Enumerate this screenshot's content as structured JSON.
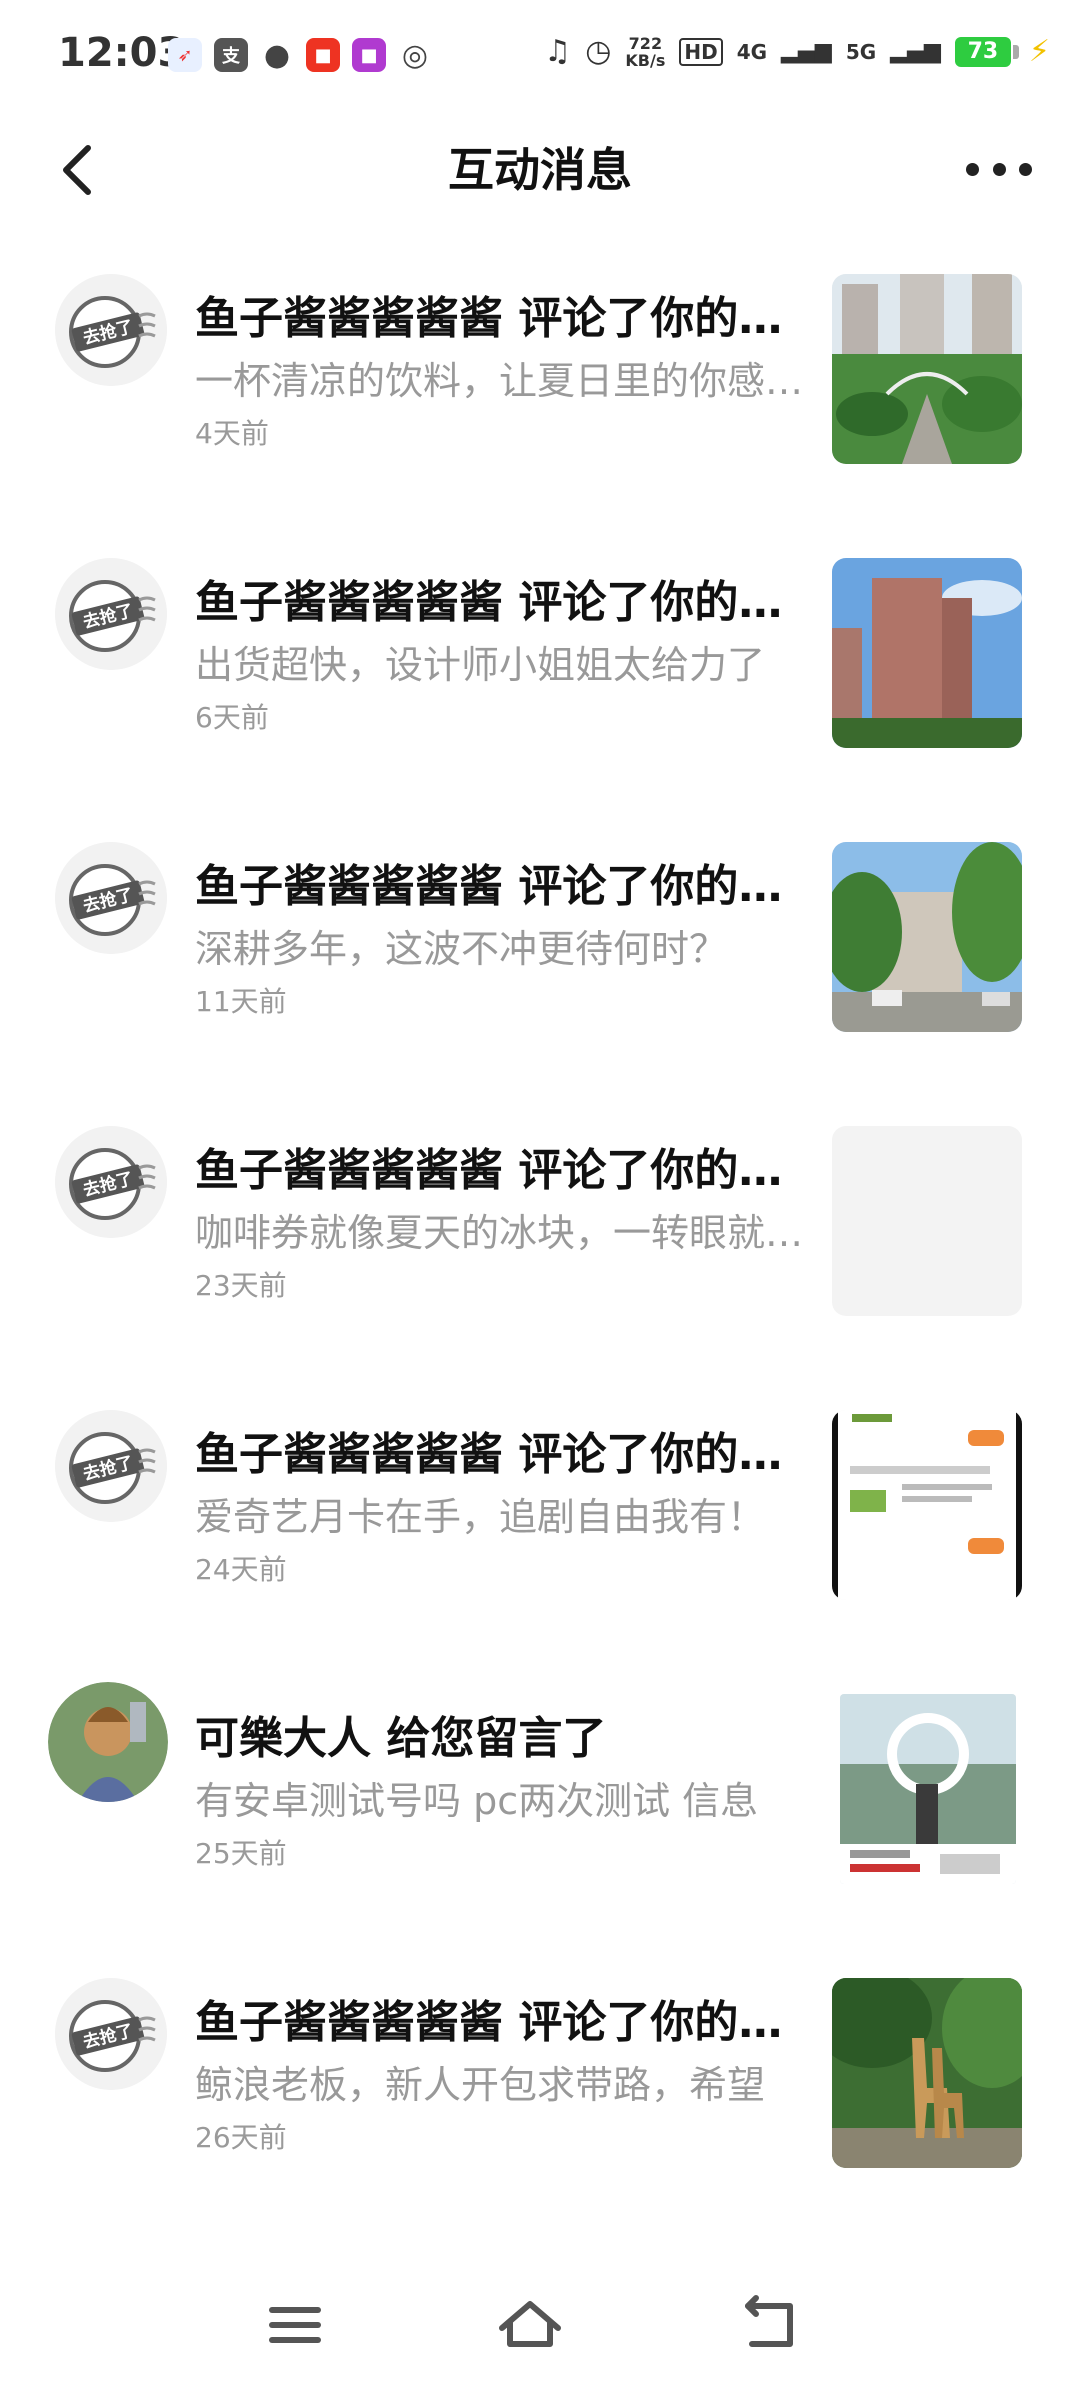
{
  "status_bar": {
    "time": "12:03",
    "net_speed_value": "722",
    "net_speed_unit": "KB/s",
    "hd_label": "HD",
    "signal_1": "4G",
    "signal_2": "5G",
    "battery": "73"
  },
  "header": {
    "title": "互动消息"
  },
  "messages": [
    {
      "title": "鱼子酱酱酱酱酱 评论了你的动态",
      "preview": "一杯清凉的饮料，让夏日里的你感到清爽",
      "time": "4天前",
      "avatar": "去抢了"
    },
    {
      "title": "鱼子酱酱酱酱酱 评论了你的动态",
      "preview": "出货超快，设计师小姐姐太给力了",
      "time": "6天前",
      "avatar": "去抢了"
    },
    {
      "title": "鱼子酱酱酱酱酱 评论了你的动态",
      "preview": "深耕多年，这波不冲更待何时？",
      "time": "11天前",
      "avatar": "去抢了"
    },
    {
      "title": "鱼子酱酱酱酱酱 评论了你的动态",
      "preview": "咖啡券就像夏天的冰块，一转眼就没了",
      "time": "23天前",
      "avatar": "去抢了"
    },
    {
      "title": "鱼子酱酱酱酱酱 评论了你的动态",
      "preview": "爱奇艺月卡在手，追剧自由我有！",
      "time": "24天前",
      "avatar": "去抢了"
    },
    {
      "title": "可樂大人 给您留言了",
      "preview": "有安卓测试号吗 pc两次测试 信息",
      "time": "25天前",
      "avatar": ""
    },
    {
      "title": "鱼子酱酱酱酱酱 评论了你的动态",
      "preview": "鲸浪老板，新人开包求带路，希望",
      "time": "26天前",
      "avatar": "去抢了"
    }
  ],
  "colors": {
    "title_text": "#111111",
    "preview_text": "#999999",
    "time_text": "#9a9a9a",
    "battery": "#2ecc40"
  }
}
